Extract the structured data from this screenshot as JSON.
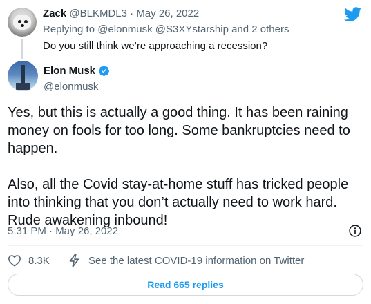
{
  "colors": {
    "text_primary": "#0f1419",
    "text_secondary": "#536471",
    "accent": "#1d9bf0",
    "divider": "#eff3f4",
    "button_border": "#cfd9de"
  },
  "reply_tweet": {
    "name": "Zack",
    "handle": "@BLKMDL3",
    "separator": "·",
    "date": "May 26, 2022",
    "replying_prefix": "Replying to",
    "mentions": "@elonmusk @S3XYstarship",
    "others": "and 2 others",
    "text": "Do you still think we’re approaching a recession?"
  },
  "main_tweet": {
    "name": "Elon Musk",
    "handle": "@elonmusk",
    "body_paragraph_1": "Yes, but this is actually a good thing. It has been raining money on fools for too long. Some bankruptcies need to happen.",
    "body_paragraph_2": "Also, all the Covid stay-at-home stuff has tricked people into thinking that you don’t actually need to work hard. Rude awakening inbound!",
    "timestamp": "5:31 PM · May 26, 2022"
  },
  "actions": {
    "like_count": "8.3K",
    "covid_info": "See the latest COVID-19 information on Twitter",
    "read_replies": "Read 665 replies"
  },
  "icons": {
    "brand": "twitter-bird-icon",
    "verified": "verified-badge-icon",
    "info": "info-icon",
    "like": "heart-icon",
    "covid": "bolt-icon"
  }
}
